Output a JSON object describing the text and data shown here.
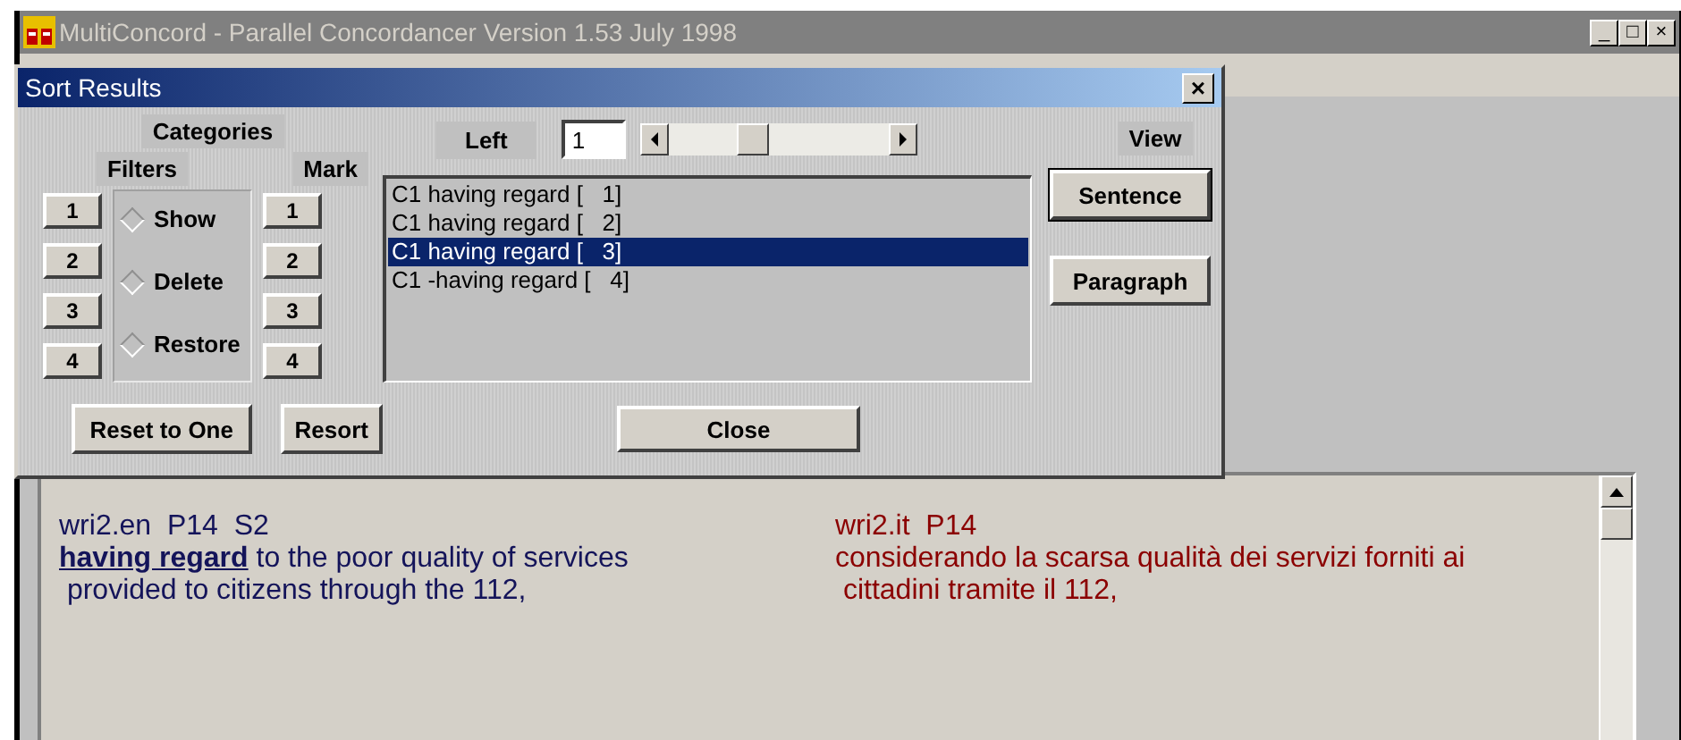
{
  "window": {
    "title": "MultiConcord - Parallel Concordancer Version 1.53 July 1998",
    "controls": [
      "_",
      "□",
      "×"
    ]
  },
  "dialog": {
    "title": "Sort Results",
    "close": "×",
    "categories_label": "Categories",
    "filters_label": "Filters",
    "mark_label": "Mark",
    "filter_buttons": [
      "1",
      "2",
      "3",
      "4"
    ],
    "mark_buttons": [
      "1",
      "2",
      "3",
      "4"
    ],
    "actions": [
      {
        "label": "Show",
        "selected": false
      },
      {
        "label": "Delete",
        "selected": false
      },
      {
        "label": "Restore",
        "selected": false
      }
    ],
    "left_label": "Left",
    "left_value": "1",
    "left_slider": {
      "level": 0.36
    },
    "results": [
      {
        "text": "C1 having regard [   1]",
        "selected": false
      },
      {
        "text": "C1 having regard [   2]",
        "selected": false
      },
      {
        "text": "C1 having regard [   3]",
        "selected": true
      },
      {
        "text": "C1 -having regard [   4]",
        "selected": false
      }
    ],
    "view_label": "View",
    "view_buttons": [
      {
        "label": "Sentence",
        "selected": true
      },
      {
        "label": "Paragraph",
        "selected": false
      }
    ],
    "reset_button": "Reset to One",
    "resort_button": "Resort",
    "close_button": "Close"
  },
  "document": {
    "source": {
      "header": "wri2.en  P14  S2",
      "lines": [
        "**having regard** to the poor quality of services",
        " provided to citizens through the 112,"
      ]
    },
    "target": {
      "header": "wri2.it  P14",
      "lines": [
        "considerando la scarsa qualità dei servizi forniti ai",
        " cittadini tramite il 112,"
      ]
    }
  }
}
